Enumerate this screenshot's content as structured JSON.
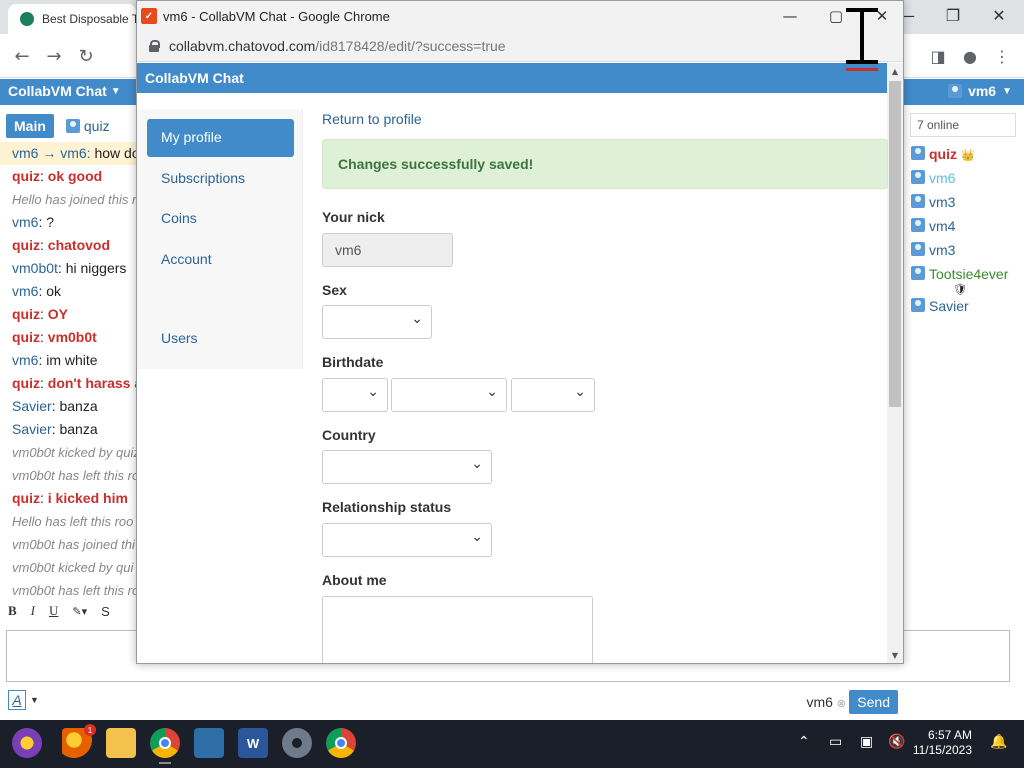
{
  "bg_browser": {
    "tab_title": "Best Disposable T",
    "window_controls": [
      "—",
      "❐",
      "✕"
    ]
  },
  "cv_page": {
    "brand": "CollabVM Chat",
    "user": "vm6",
    "tab_main": "Main",
    "tab_quiz": "quiz",
    "online": "7 online",
    "chat": [
      {
        "type": "priv",
        "nick": "vm6 → vm6: ",
        "text": "how do y"
      },
      {
        "type": "msg",
        "nick": "quiz",
        "text": "ok good",
        "red": true
      },
      {
        "type": "sys",
        "text": "Hello has joined this r"
      },
      {
        "type": "msg",
        "nick": "vm6",
        "text": "?",
        "red": false
      },
      {
        "type": "msg",
        "nick": "quiz",
        "text": "chatovod",
        "red": true
      },
      {
        "type": "msg",
        "nick": "vm0b0t",
        "text": "hi niggers",
        "red": false
      },
      {
        "type": "msg",
        "nick": "vm6",
        "text": "ok",
        "red": false
      },
      {
        "type": "msg",
        "nick": "quiz",
        "text": "OY",
        "red": true
      },
      {
        "type": "msg",
        "nick": "quiz",
        "text": "vm0b0t",
        "red": true
      },
      {
        "type": "msg",
        "nick": "vm6",
        "text": "im white",
        "red": false
      },
      {
        "type": "msg",
        "nick": "quiz",
        "text": "don't harass ar",
        "red": true
      },
      {
        "type": "msg",
        "nick": "Savier",
        "text": "banza",
        "red": false
      },
      {
        "type": "msg",
        "nick": "Savier",
        "text": "banza",
        "red": false
      },
      {
        "type": "sys",
        "text": "vm0b0t kicked by quiz"
      },
      {
        "type": "sys",
        "text": "vm0b0t has left this ro"
      },
      {
        "type": "msg",
        "nick": "quiz",
        "text": "i kicked him",
        "red": true
      },
      {
        "type": "sys",
        "text": "Hello has left this roo"
      },
      {
        "type": "sys",
        "text": "vm0b0t has joined thi"
      },
      {
        "type": "sys",
        "text": "vm0b0t kicked by qui"
      },
      {
        "type": "sys",
        "text": "vm0b0t has left this ro"
      }
    ],
    "editor_tools": [
      "B",
      "I",
      "U",
      "✎▾",
      "S"
    ],
    "users": [
      {
        "name": "quiz",
        "color": "#c9302c",
        "bold": true,
        "badge": "👑"
      },
      {
        "name": "vm6",
        "color": "#5bc0de",
        "bold": false,
        "badge": ""
      },
      {
        "name": "vm3",
        "color": "#2a6496",
        "bold": false,
        "badge": ""
      },
      {
        "name": "vm4",
        "color": "#2a6496",
        "bold": false,
        "badge": ""
      },
      {
        "name": "vm3",
        "color": "#2a6496",
        "bold": false,
        "badge": ""
      },
      {
        "name": "Tootsie4ever",
        "color": "#3c8d2f",
        "bold": false,
        "badge": "🛡"
      },
      {
        "name": "Savier",
        "color": "#2a6496",
        "bold": false,
        "badge": ""
      }
    ],
    "footer_nick": "vm6",
    "send_label": "Send"
  },
  "popup": {
    "window_title": "vm6 - CollabVM Chat - Google Chrome",
    "url_host": "collabvm.chatovod.com",
    "url_path": "/id8178428/edit/?success=true",
    "header": "CollabVM Chat",
    "nav": [
      "My profile",
      "Subscriptions",
      "Coins",
      "Account",
      "Users"
    ],
    "return_link": "Return to profile",
    "alert": "Changes successfully saved!",
    "labels": {
      "nick": "Your nick",
      "sex": "Sex",
      "birthdate": "Birthdate",
      "country": "Country",
      "relationship": "Relationship status",
      "about": "About me"
    },
    "nick_value": "vm6"
  },
  "taskbar": {
    "time": "6:57 AM",
    "date": "11/15/2023",
    "firefox_badge": "1"
  }
}
